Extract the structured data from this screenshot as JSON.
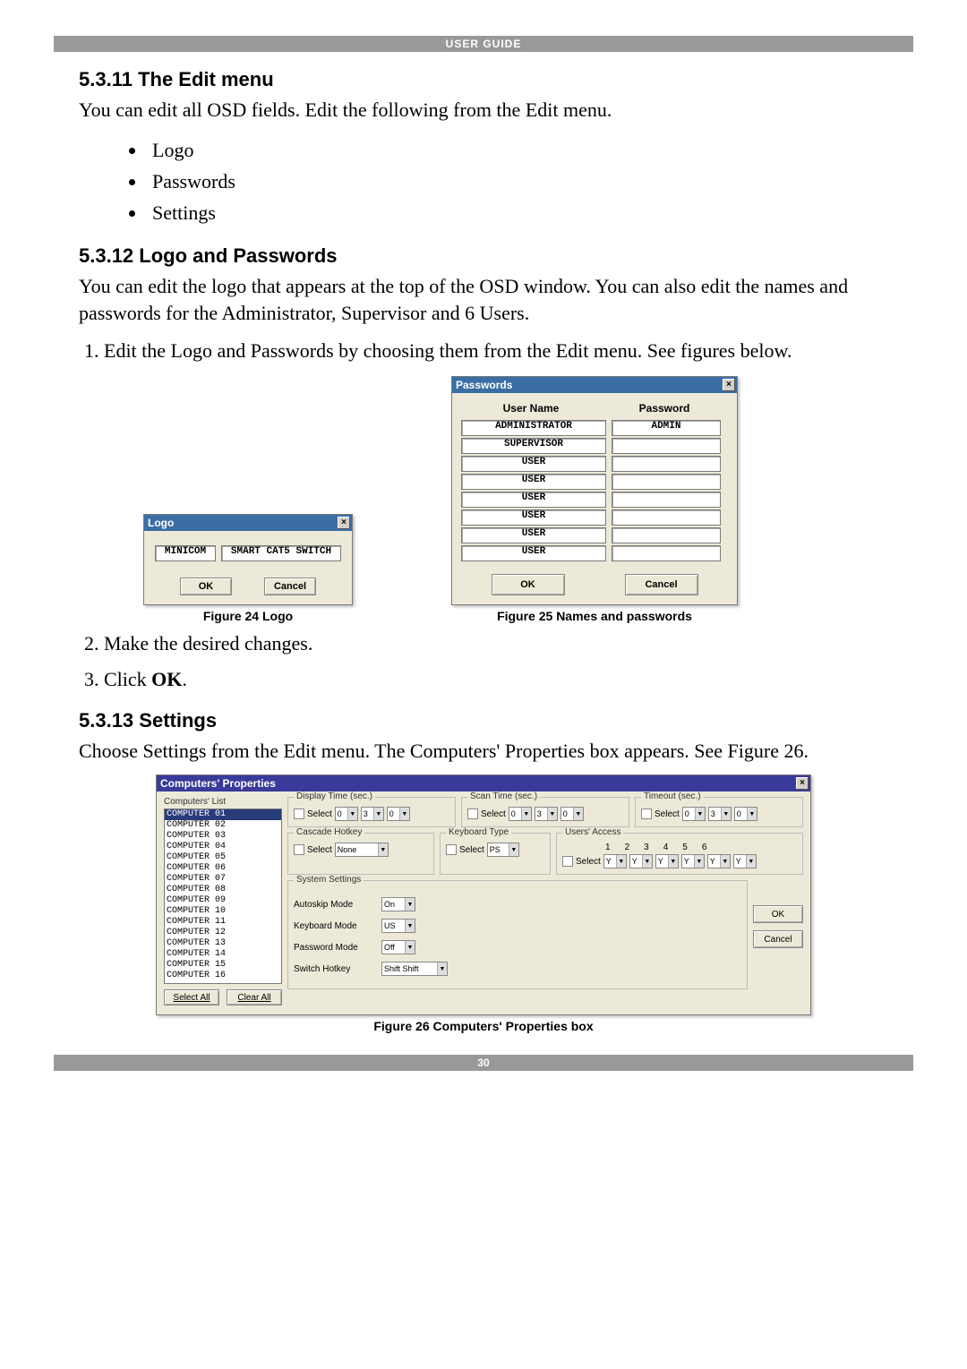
{
  "header": {
    "title": "USER GUIDE"
  },
  "section1": {
    "heading": "5.3.11 The Edit menu",
    "intro": "You can edit all OSD fields. Edit the following from the Edit menu.",
    "bullets": [
      "Logo",
      "Passwords",
      "Settings"
    ]
  },
  "section2": {
    "heading": "5.3.12 Logo and Passwords",
    "intro": "You can edit the logo that appears at the top of the OSD window. You can also edit the names and passwords for the Administrator, Supervisor and 6 Users.",
    "step1": "Edit the Logo and Passwords by choosing them from the Edit menu. See figures below.",
    "step2": "Make the desired changes.",
    "step3_pre": "Click ",
    "step3_bold": "OK",
    "step3_post": "."
  },
  "logo_dialog": {
    "title": "Logo",
    "field1": "MINICOM",
    "field2": "SMART CAT5 SWITCH",
    "ok": "OK",
    "cancel": "Cancel",
    "caption": "Figure 24 Logo"
  },
  "pw_dialog": {
    "title": "Passwords",
    "col_user": "User Name",
    "col_pw": "Password",
    "rows": [
      {
        "u": "ADMINISTRATOR",
        "p": "ADMIN"
      },
      {
        "u": "SUPERVISOR",
        "p": ""
      },
      {
        "u": "USER",
        "p": ""
      },
      {
        "u": "USER",
        "p": ""
      },
      {
        "u": "USER",
        "p": ""
      },
      {
        "u": "USER",
        "p": ""
      },
      {
        "u": "USER",
        "p": ""
      },
      {
        "u": "USER",
        "p": ""
      }
    ],
    "ok": "OK",
    "cancel": "Cancel",
    "caption": "Figure 25 Names and passwords"
  },
  "section3": {
    "heading": "5.3.13 Settings",
    "intro": "Choose Settings from the Edit menu. The Computers' Properties box appears. See Figure 26."
  },
  "settings_dialog": {
    "title": "Computers' Properties",
    "list_label": "Computers' List",
    "computers": [
      "COMPUTER 01",
      "COMPUTER 02",
      "COMPUTER 03",
      "COMPUTER 04",
      "COMPUTER 05",
      "COMPUTER 06",
      "COMPUTER 07",
      "COMPUTER 08",
      "COMPUTER 09",
      "COMPUTER 10",
      "COMPUTER 11",
      "COMPUTER 12",
      "COMPUTER 13",
      "COMPUTER 14",
      "COMPUTER 15",
      "COMPUTER 16"
    ],
    "select_all": "Select All",
    "clear_all": "Clear All",
    "groups": {
      "display_time": {
        "legend": "Display Time (sec.)",
        "select": "Select",
        "v1": "0",
        "v2": "3",
        "v3": "0"
      },
      "scan_time": {
        "legend": "Scan Time (sec.)",
        "select": "Select",
        "v1": "0",
        "v2": "3",
        "v3": "0"
      },
      "timeout": {
        "legend": "Timeout (sec.)",
        "select": "Select",
        "v1": "0",
        "v2": "3",
        "v3": "0"
      },
      "cascade": {
        "legend": "Cascade Hotkey",
        "select": "Select",
        "value": "None"
      },
      "keyboard_type": {
        "legend": "Keyboard Type",
        "select": "Select",
        "value": "PS"
      },
      "users_access": {
        "legend": "Users' Access",
        "nums": [
          "1",
          "2",
          "3",
          "4",
          "5",
          "6"
        ],
        "select": "Select",
        "val": "Y"
      }
    },
    "system": {
      "legend": "System Settings",
      "autoskip_lbl": "Autoskip Mode",
      "autoskip_val": "On",
      "kbdmode_lbl": "Keyboard Mode",
      "kbdmode_val": "US",
      "pwmode_lbl": "Password Mode",
      "pwmode_val": "Off",
      "switchhk_lbl": "Switch Hotkey",
      "switchhk_val": "Shift Shift"
    },
    "ok": "OK",
    "cancel": "Cancel",
    "caption": "Figure 26 Computers' Properties box"
  },
  "footer": {
    "page": "30"
  }
}
